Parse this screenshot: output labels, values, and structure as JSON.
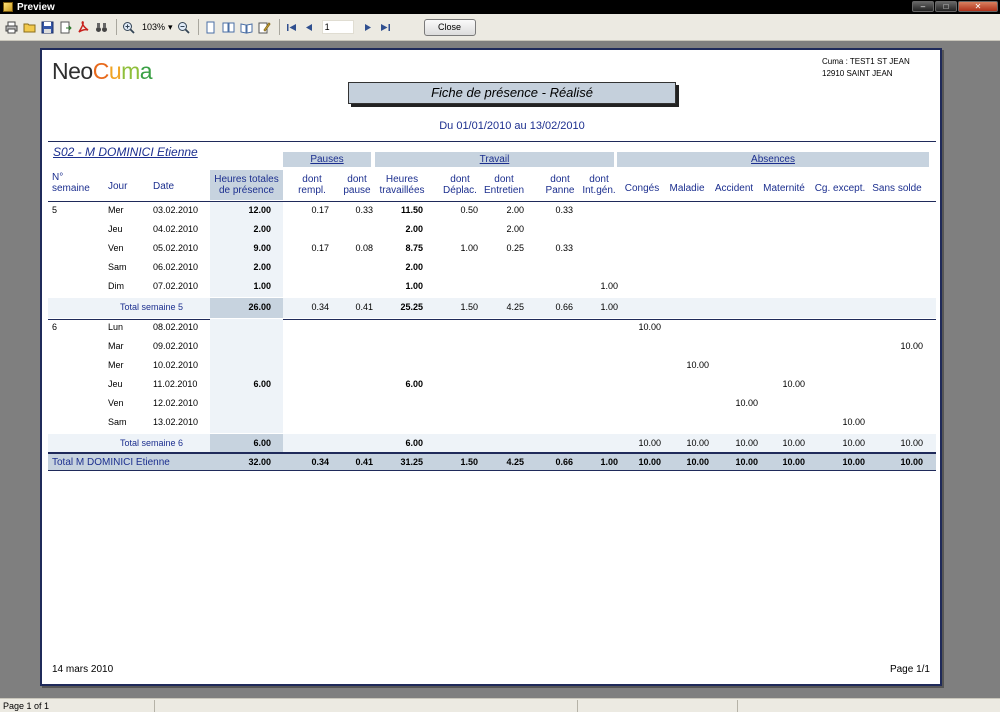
{
  "window": {
    "title": "Preview"
  },
  "toolbar": {
    "zoom": "103%",
    "page_number": "1",
    "close_label": "Close"
  },
  "header": {
    "logo": {
      "neo": "Neo",
      "cuma": "Cuma"
    },
    "cuma_line1": "Cuma : TEST1  ST JEAN",
    "cuma_line2": "12910  SAINT JEAN",
    "doc_title": "Fiche de présence - Réalisé",
    "period": "Du 01/01/2010 au 13/02/2010"
  },
  "person": "S02 - M  DOMINICI  Etienne",
  "groups": {
    "pauses": "Pauses",
    "travail": "Travail",
    "absences": "Absences"
  },
  "columns": {
    "semaine": "N°\nsemaine",
    "jour": "Jour",
    "date": "Date",
    "heures_totales": "Heures totales de présence",
    "dont_rempl": "dont rempl.",
    "dont_pause": "dont pause",
    "heures_travaillees": "Heures travaillées",
    "dont_deplac": "dont Déplac.",
    "dont_entretien": "dont Entretien",
    "dont_panne": "dont Panne",
    "dont_intgen": "dont Int.gén.",
    "conges": "Congés",
    "maladie": "Maladie",
    "accident": "Accident",
    "maternite": "Maternité",
    "cg_except": "Cg. except.",
    "sans_solde": "Sans solde"
  },
  "weeks": [
    {
      "num": "5",
      "days": [
        {
          "jour": "Mer",
          "date": "03.02.2010",
          "ht": "12.00",
          "rempl": "0.17",
          "pause": "0.33",
          "trav": "11.50",
          "deplac": "0.50",
          "entretien": "2.00",
          "panne": "0.33",
          "intgen": "",
          "conges": "",
          "maladie": "",
          "accident": "",
          "maternite": "",
          "cgexcept": "",
          "sanssolde": ""
        },
        {
          "jour": "Jeu",
          "date": "04.02.2010",
          "ht": "2.00",
          "rempl": "",
          "pause": "",
          "trav": "2.00",
          "deplac": "",
          "entretien": "2.00",
          "panne": "",
          "intgen": "",
          "conges": "",
          "maladie": "",
          "accident": "",
          "maternite": "",
          "cgexcept": "",
          "sanssolde": ""
        },
        {
          "jour": "Ven",
          "date": "05.02.2010",
          "ht": "9.00",
          "rempl": "0.17",
          "pause": "0.08",
          "trav": "8.75",
          "deplac": "1.00",
          "entretien": "0.25",
          "panne": "0.33",
          "intgen": "",
          "conges": "",
          "maladie": "",
          "accident": "",
          "maternite": "",
          "cgexcept": "",
          "sanssolde": ""
        },
        {
          "jour": "Sam",
          "date": "06.02.2010",
          "ht": "2.00",
          "rempl": "",
          "pause": "",
          "trav": "2.00",
          "deplac": "",
          "entretien": "",
          "panne": "",
          "intgen": "",
          "conges": "",
          "maladie": "",
          "accident": "",
          "maternite": "",
          "cgexcept": "",
          "sanssolde": ""
        },
        {
          "jour": "Dim",
          "date": "07.02.2010",
          "ht": "1.00",
          "rempl": "",
          "pause": "",
          "trav": "1.00",
          "deplac": "",
          "entretien": "",
          "panne": "",
          "intgen": "1.00",
          "conges": "",
          "maladie": "",
          "accident": "",
          "maternite": "",
          "cgexcept": "",
          "sanssolde": ""
        }
      ],
      "total": {
        "label": "Total semaine 5",
        "ht": "26.00",
        "rempl": "0.34",
        "pause": "0.41",
        "trav": "25.25",
        "deplac": "1.50",
        "entretien": "4.25",
        "panne": "0.66",
        "intgen": "1.00",
        "conges": "",
        "maladie": "",
        "accident": "",
        "maternite": "",
        "cgexcept": "",
        "sanssolde": ""
      }
    },
    {
      "num": "6",
      "days": [
        {
          "jour": "Lun",
          "date": "08.02.2010",
          "ht": "",
          "rempl": "",
          "pause": "",
          "trav": "",
          "deplac": "",
          "entretien": "",
          "panne": "",
          "intgen": "",
          "conges": "10.00",
          "maladie": "",
          "accident": "",
          "maternite": "",
          "cgexcept": "",
          "sanssolde": ""
        },
        {
          "jour": "Mar",
          "date": "09.02.2010",
          "ht": "",
          "rempl": "",
          "pause": "",
          "trav": "",
          "deplac": "",
          "entretien": "",
          "panne": "",
          "intgen": "",
          "conges": "",
          "maladie": "",
          "accident": "",
          "maternite": "",
          "cgexcept": "",
          "sanssolde": "10.00"
        },
        {
          "jour": "Mer",
          "date": "10.02.2010",
          "ht": "",
          "rempl": "",
          "pause": "",
          "trav": "",
          "deplac": "",
          "entretien": "",
          "panne": "",
          "intgen": "",
          "conges": "",
          "maladie": "10.00",
          "accident": "",
          "maternite": "",
          "cgexcept": "",
          "sanssolde": ""
        },
        {
          "jour": "Jeu",
          "date": "11.02.2010",
          "ht": "6.00",
          "rempl": "",
          "pause": "",
          "trav": "6.00",
          "deplac": "",
          "entretien": "",
          "panne": "",
          "intgen": "",
          "conges": "",
          "maladie": "",
          "accident": "",
          "maternite": "10.00",
          "cgexcept": "",
          "sanssolde": ""
        },
        {
          "jour": "Ven",
          "date": "12.02.2010",
          "ht": "",
          "rempl": "",
          "pause": "",
          "trav": "",
          "deplac": "",
          "entretien": "",
          "panne": "",
          "intgen": "",
          "conges": "",
          "maladie": "",
          "accident": "10.00",
          "maternite": "",
          "cgexcept": "",
          "sanssolde": ""
        },
        {
          "jour": "Sam",
          "date": "13.02.2010",
          "ht": "",
          "rempl": "",
          "pause": "",
          "trav": "",
          "deplac": "",
          "entretien": "",
          "panne": "",
          "intgen": "",
          "conges": "",
          "maladie": "",
          "accident": "",
          "maternite": "",
          "cgexcept": "10.00",
          "sanssolde": ""
        }
      ],
      "total": {
        "label": "Total semaine 6",
        "ht": "6.00",
        "rempl": "",
        "pause": "",
        "trav": "6.00",
        "deplac": "",
        "entretien": "",
        "panne": "",
        "intgen": "",
        "conges": "10.00",
        "maladie": "10.00",
        "accident": "10.00",
        "maternite": "10.00",
        "cgexcept": "10.00",
        "sanssolde": "10.00"
      }
    }
  ],
  "grand_total": {
    "label": "Total M  DOMINICI  Etienne",
    "ht": "32.00",
    "rempl": "0.34",
    "pause": "0.41",
    "trav": "31.25",
    "deplac": "1.50",
    "entretien": "4.25",
    "panne": "0.66",
    "intgen": "1.00",
    "conges": "10.00",
    "maladie": "10.00",
    "accident": "10.00",
    "maternite": "10.00",
    "cgexcept": "10.00",
    "sanssolde": "10.00"
  },
  "footer": {
    "date": "14 mars 2010",
    "page": "Page 1/1"
  },
  "statusbar": {
    "page_info": "Page 1 of 1"
  }
}
